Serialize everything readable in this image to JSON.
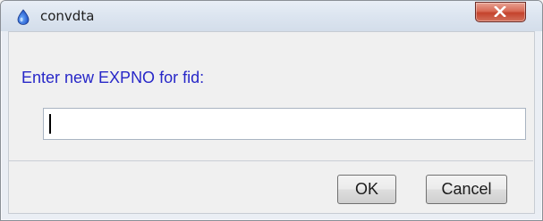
{
  "window": {
    "title": "convdta",
    "app_icon": "topspin-drop-icon",
    "close_icon": "close-x-icon"
  },
  "dialog": {
    "prompt": "Enter new EXPNO for fid:",
    "input_value": "",
    "ok_label": "OK",
    "cancel_label": "Cancel"
  },
  "colors": {
    "prompt_text": "#2727c8",
    "close_button": "#c4432c",
    "title_bar": "#dce5f0"
  }
}
